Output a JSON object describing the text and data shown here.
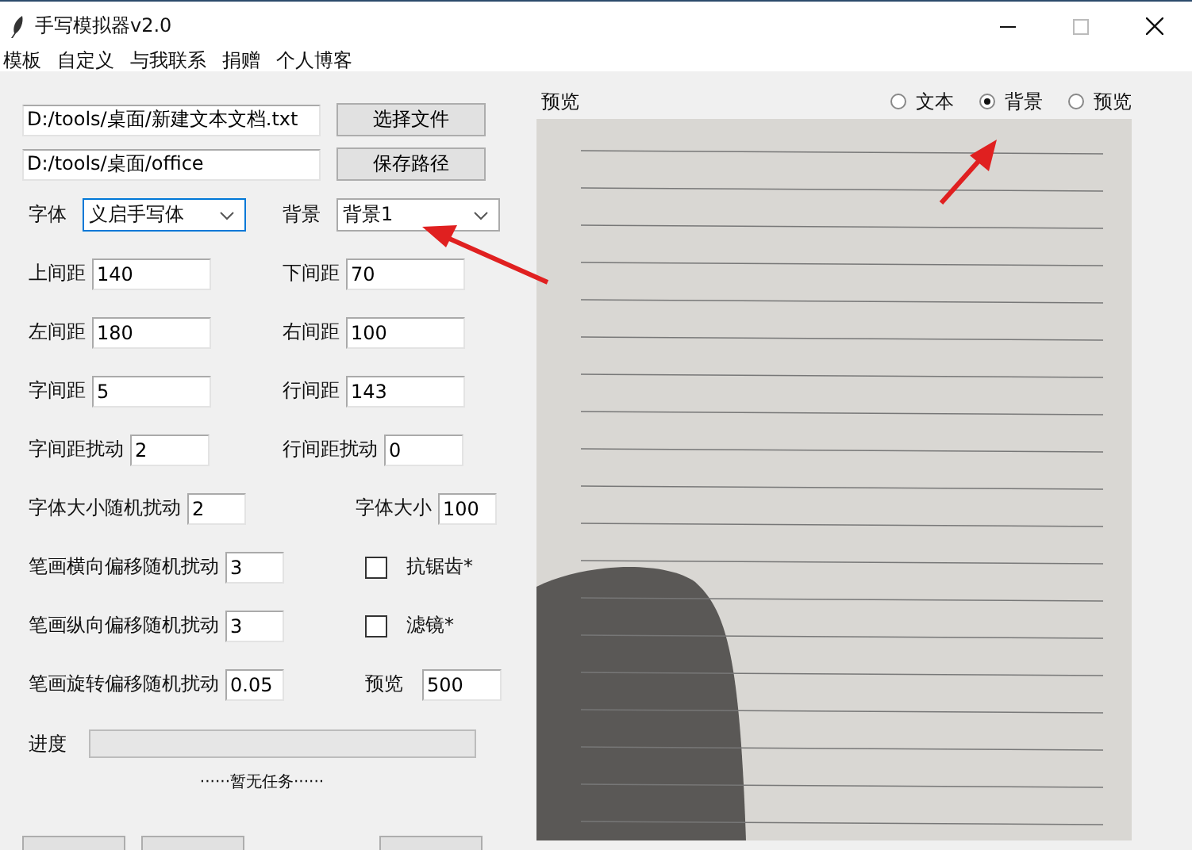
{
  "window": {
    "title": "手写模拟器v2.0"
  },
  "menu": [
    "模板",
    "自定义",
    "与我联系",
    "捐赠",
    "个人博客"
  ],
  "files": [
    {
      "value": "D:/tools/桌面/新建文本文档.txt",
      "button": "选择文件"
    },
    {
      "value": "D:/tools/桌面/office",
      "button": "保存路径"
    }
  ],
  "selects": [
    {
      "label": "字体",
      "value": "义启手写体"
    },
    {
      "label": "背景",
      "value": "背景1"
    }
  ],
  "params": [
    {
      "left": {
        "label": "上间距",
        "value": "140"
      },
      "right": {
        "kind": "field",
        "label": "下间距",
        "value": "70"
      }
    },
    {
      "left": {
        "label": "左间距",
        "value": "180"
      },
      "right": {
        "kind": "field",
        "label": "右间距",
        "value": "100"
      }
    },
    {
      "left": {
        "label": "字间距",
        "value": "5"
      },
      "right": {
        "kind": "field",
        "label": "行间距",
        "value": "143"
      }
    },
    {
      "left": {
        "label": "字间距扰动",
        "value": "2"
      },
      "right": {
        "kind": "field",
        "label": "行间距扰动",
        "value": "0"
      }
    },
    {
      "left": {
        "label": "字体大小随机扰动",
        "value": "2"
      },
      "right": {
        "kind": "field",
        "label": "字体大小",
        "value": "100"
      }
    },
    {
      "left": {
        "label": "笔画横向偏移随机扰动",
        "value": "3"
      },
      "right": {
        "kind": "checkbox",
        "label": "抗锯齿*",
        "checked": false
      }
    },
    {
      "left": {
        "label": "笔画纵向偏移随机扰动",
        "value": "3"
      },
      "right": {
        "kind": "checkbox",
        "label": "滤镜*",
        "checked": false
      }
    },
    {
      "left": {
        "label": "笔画旋转偏移随机扰动",
        "value": "0.05"
      },
      "right": {
        "kind": "field",
        "label": "预览",
        "value": "500"
      }
    }
  ],
  "progress": {
    "label": "进度",
    "level": 0
  },
  "status": "······暂无任务······",
  "preview": {
    "title": "预览",
    "modes": [
      {
        "label": "文本",
        "selected": false
      },
      {
        "label": "背景",
        "selected": true
      },
      {
        "label": "预览",
        "selected": false
      }
    ]
  }
}
